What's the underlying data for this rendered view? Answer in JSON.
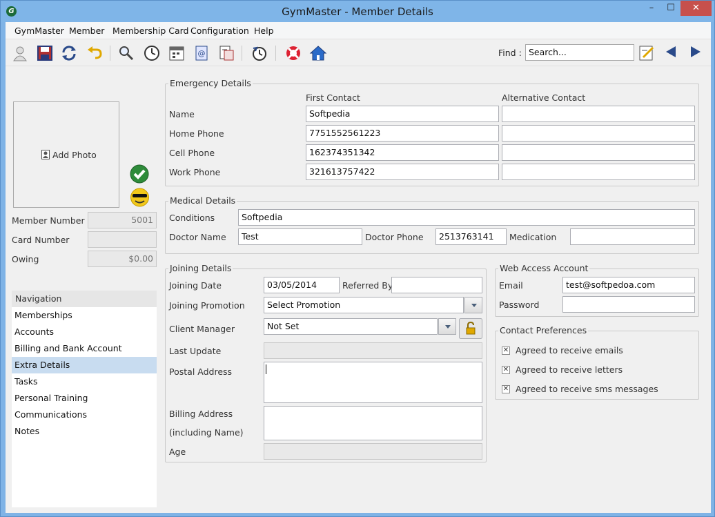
{
  "window": {
    "title": "GymMaster - Member Details",
    "min": "–",
    "max": "☐",
    "close": "✕"
  },
  "menu": [
    "GymMaster",
    "Member",
    "Membership Card",
    "Configuration",
    "Help"
  ],
  "find": {
    "label": "Find :",
    "placeholder": "Search..."
  },
  "photo": {
    "add_label": "Add Photo"
  },
  "member": {
    "number_label": "Member Number",
    "number": "5001",
    "card_label": "Card Number",
    "card": "",
    "owing_label": "Owing",
    "owing": "$0.00"
  },
  "navigation": {
    "header": "Navigation",
    "items": [
      "Memberships",
      "Accounts",
      "Billing and Bank Account",
      "Extra Details",
      "Tasks",
      "Personal Training",
      "Communications",
      "Notes"
    ],
    "active": "Extra Details"
  },
  "emergency": {
    "title": "Emergency Details",
    "col_first": "First Contact",
    "col_alt": "Alternative Contact",
    "rows": [
      {
        "label": "Name",
        "first": "Softpedia",
        "alt": ""
      },
      {
        "label": "Home Phone",
        "first": "7751552561223",
        "alt": ""
      },
      {
        "label": "Cell Phone",
        "first": "162374351342",
        "alt": ""
      },
      {
        "label": "Work Phone",
        "first": "321613757422",
        "alt": ""
      }
    ]
  },
  "medical": {
    "title": "Medical Details",
    "conditions_label": "Conditions",
    "conditions": "Softpedia",
    "doctor_name_label": "Doctor Name",
    "doctor_name": "Test",
    "doctor_phone_label": "Doctor Phone",
    "doctor_phone": "2513763141",
    "medication_label": "Medication",
    "medication": ""
  },
  "joining": {
    "title": "Joining Details",
    "date_label": "Joining Date",
    "date": "03/05/2014",
    "referred_label": "Referred By",
    "referred": "",
    "promotion_label": "Joining Promotion",
    "promotion": "Select Promotion",
    "manager_label": "Client Manager",
    "manager": "Not Set",
    "last_update_label": "Last Update",
    "last_update": "",
    "postal_label": "Postal Address",
    "billing_label_1": "Billing Address",
    "billing_label_2": "(including Name)",
    "age_label": "Age",
    "age": ""
  },
  "web": {
    "title": "Web Access Account",
    "email_label": "Email",
    "email": "test@softpedoa.com",
    "password_label": "Password",
    "password": ""
  },
  "contact": {
    "title": "Contact Preferences",
    "items": [
      {
        "label": "Agreed to receive emails",
        "checked": true
      },
      {
        "label": "Agreed to receive letters",
        "checked": true
      },
      {
        "label": "Agreed to receive sms messages",
        "checked": true
      }
    ]
  },
  "colors": {
    "titlebar": "#7fb5e8",
    "close": "#c7504c",
    "nav_active": "#c8dcf0",
    "check_green": "#2e8b3a",
    "smiley_yellow": "#f2c81a"
  },
  "toolbar_icons": [
    "new-member-icon",
    "save-icon",
    "refresh-icon",
    "undo-icon",
    "search-icon",
    "clock-icon",
    "calendar-icon",
    "email-icon",
    "report-icon",
    "history-icon",
    "help-lifebuoy-icon",
    "home-icon"
  ]
}
